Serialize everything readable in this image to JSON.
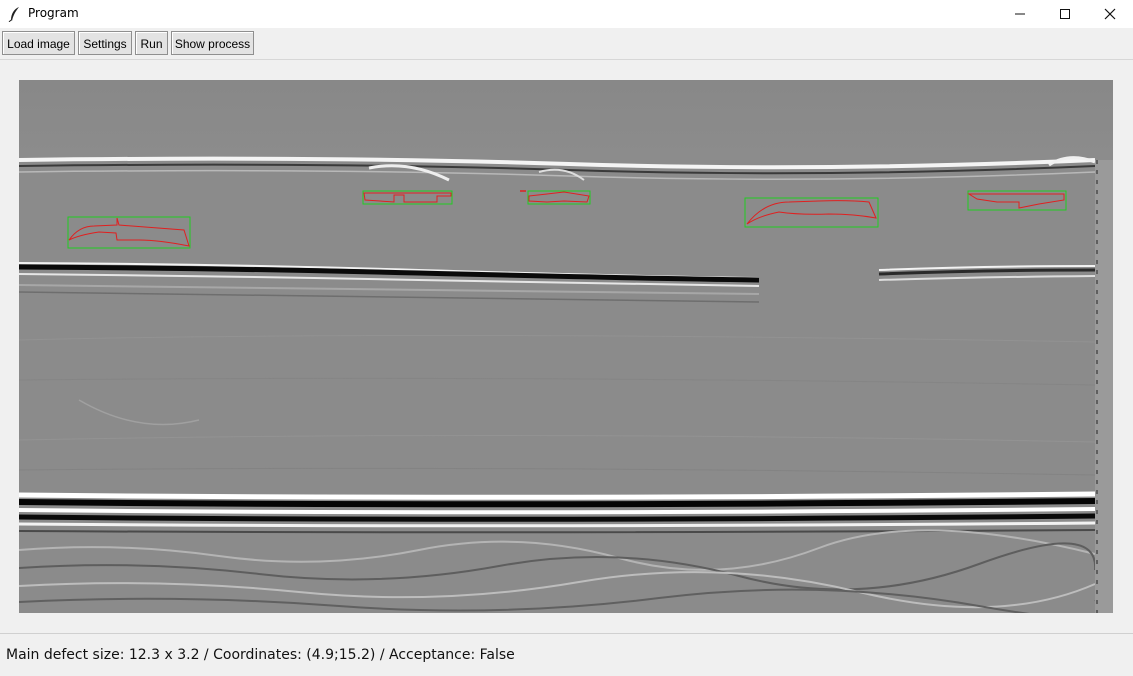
{
  "window": {
    "title": "Program",
    "icon": "feather-icon",
    "controls": [
      "minimize-icon",
      "maximize-icon",
      "close-icon"
    ]
  },
  "toolbar": {
    "load_label": "Load image",
    "settings_label": "Settings",
    "run_label": "Run",
    "show_process_label": "Show process"
  },
  "image_view": {
    "background": "#8a8a8a",
    "defect_box_color": "#22cc22",
    "defect_contour_color": "#e02020",
    "detected_defects": 5
  },
  "status": {
    "text": "Main defect size: 12.3 x 3.2 / Coordinates: (4.9;15.2) / Acceptance: False"
  }
}
